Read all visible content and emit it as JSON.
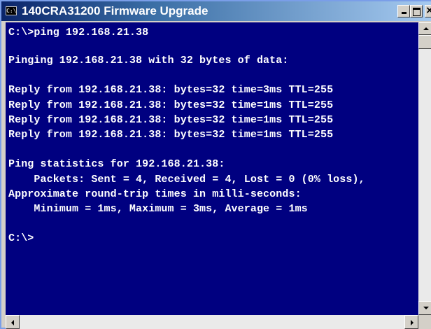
{
  "window": {
    "title": "140CRA31200 Firmware Upgrade",
    "icon": "console-icon",
    "icon_text": "C:\\",
    "minimize_icon": "minimize-icon",
    "maximize_icon": "maximize-icon",
    "close_label": "×"
  },
  "console": {
    "background": "#000080",
    "foreground": "#ffffff",
    "lines": [
      "C:\\>ping 192.168.21.38",
      "Pinging 192.168.21.38 with 32 bytes of data:",
      "Reply from 192.168.21.38: bytes=32 time=3ms TTL=255",
      "Reply from 192.168.21.38: bytes=32 time=1ms TTL=255",
      "Reply from 192.168.21.38: bytes=32 time=1ms TTL=255",
      "Reply from 192.168.21.38: bytes=32 time=1ms TTL=255",
      "Ping statistics for 192.168.21.38:",
      "    Packets: Sent = 4, Received = 4, Lost = 0 (0% loss),",
      "Approximate round-trip times in milli-seconds:",
      "    Minimum = 1ms, Maximum = 3ms, Average = 1ms",
      "C:\\>"
    ]
  },
  "scrollbars": {
    "vertical_up_icon": "arrow-up-icon",
    "vertical_down_icon": "arrow-down-icon",
    "horizontal_left_icon": "arrow-left-icon",
    "horizontal_right_icon": "arrow-right-icon"
  }
}
